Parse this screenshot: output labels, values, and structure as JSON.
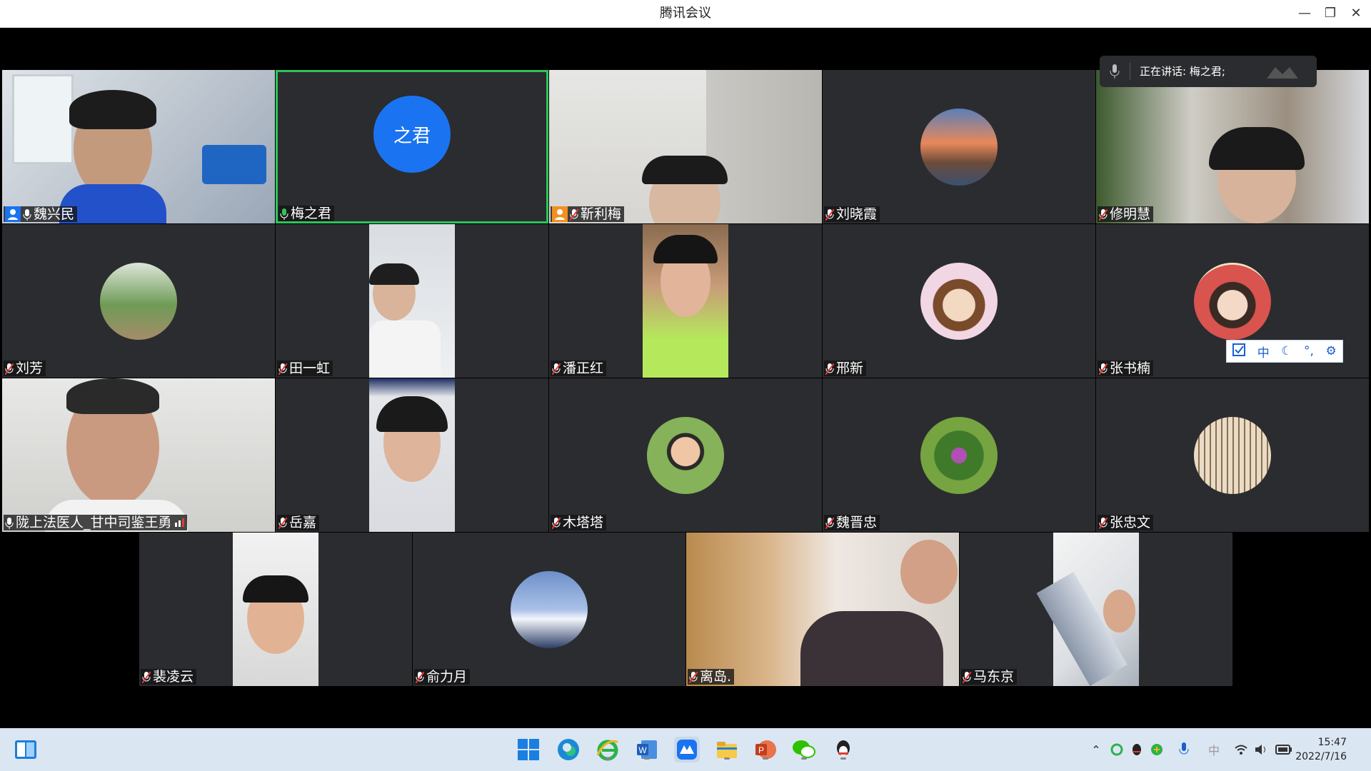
{
  "window": {
    "title": "腾讯会议",
    "minimize": "—",
    "restore": "❐",
    "close": "✕"
  },
  "speaking": {
    "label": "正在讲话: 梅之君;"
  },
  "participants": [
    {
      "name": "魏兴民",
      "host": true
    },
    {
      "name": "梅之君",
      "avatar_text": "之君",
      "active": true
    },
    {
      "name": "靳利梅",
      "cohost": true
    },
    {
      "name": "刘晓霞"
    },
    {
      "name": "修明慧"
    },
    {
      "name": "刘芳"
    },
    {
      "name": "田一虹"
    },
    {
      "name": "潘正红"
    },
    {
      "name": "邢新"
    },
    {
      "name": "张书楠"
    },
    {
      "name": "陇上法医人_甘中司鉴王勇"
    },
    {
      "name": "岳嘉"
    },
    {
      "name": "木塔塔"
    },
    {
      "name": "魏晋忠"
    },
    {
      "name": "张忠文"
    },
    {
      "name": "裴凌云"
    },
    {
      "name": "俞力月"
    },
    {
      "name": "离岛."
    },
    {
      "name": "马东京"
    }
  ],
  "ime": {
    "mode": "中",
    "moon": "☾",
    "punct": "°,",
    "settings": "⚙"
  },
  "taskbar": {
    "apps": [
      "start-icon",
      "edge-icon",
      "ie-icon",
      "word-icon",
      "tencent-meeting-icon",
      "file-explorer-icon",
      "powerpoint-icon",
      "wechat-icon",
      "qq-icon"
    ],
    "tray_lang": "中",
    "time": "15:47",
    "date": "2022/7/16"
  },
  "colors": {
    "active_border": "#2ec45a",
    "avatar_blue": "#1a73f0",
    "host_blue": "#1a73f0",
    "cohost_orange": "#f39020",
    "tile_bg": "#2b2c2f"
  }
}
